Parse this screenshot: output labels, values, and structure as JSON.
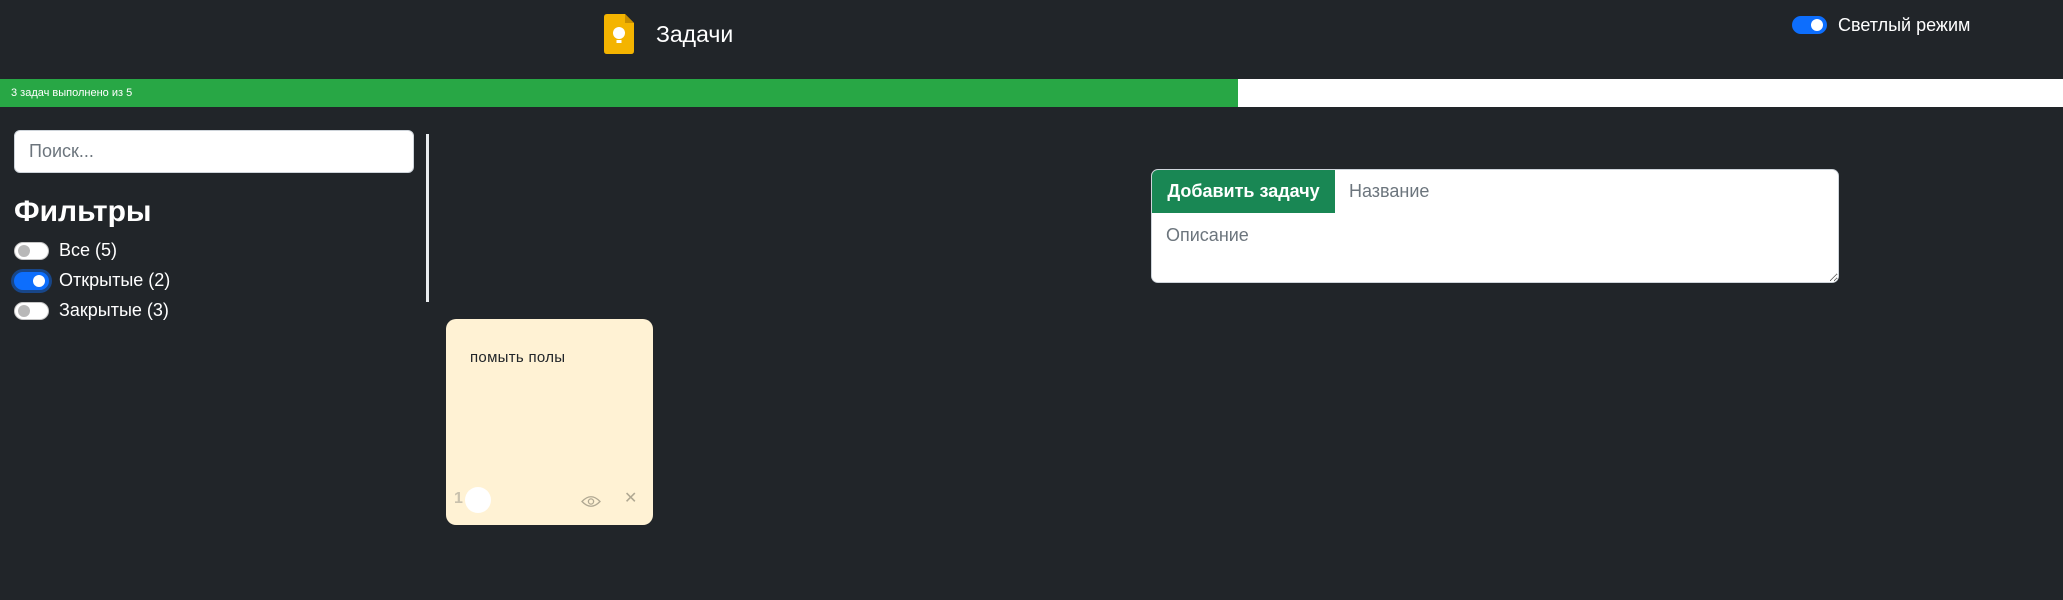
{
  "header": {
    "title": "Задачи",
    "logo_icon": "keep-bulb-icon",
    "theme_toggle": {
      "label": "Светлый режим",
      "checked": true
    }
  },
  "progress": {
    "text": "3 задач выполнено из 5",
    "completed": 3,
    "total": 5,
    "fraction": 0.6,
    "fill_color": "#28a745"
  },
  "sidebar": {
    "search_placeholder": "Поиск...",
    "filters_title": "Фильтры",
    "filters": [
      {
        "label": "Все (5)",
        "checked": false
      },
      {
        "label": "Открытые (2)",
        "checked": true
      },
      {
        "label": "Закрытые (3)",
        "checked": false
      }
    ]
  },
  "add_form": {
    "button_label": "Добавить задачу",
    "title_placeholder": "Название",
    "description_placeholder": "Описание",
    "button_color": "#198754"
  },
  "tasks": [
    {
      "title": "помыть полы",
      "number": "1",
      "color": "#fff2d4"
    }
  ],
  "colors": {
    "background": "#212529",
    "accent": "#0d6efd"
  }
}
